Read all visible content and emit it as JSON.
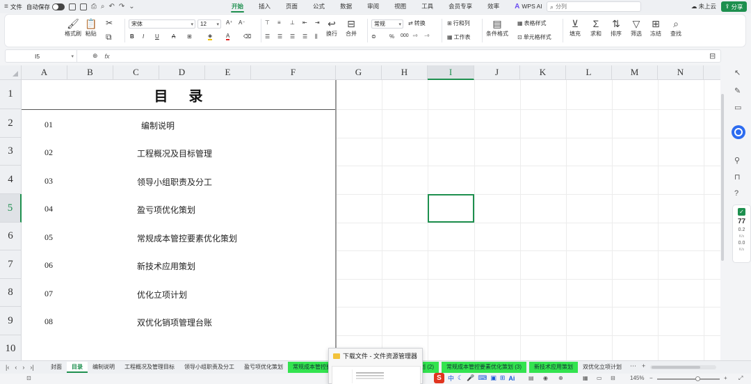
{
  "menubar": {
    "file": "文件",
    "autosave": "自动保存",
    "tabs": [
      "开始",
      "插入",
      "页面",
      "公式",
      "数据",
      "审阅",
      "视图",
      "工具",
      "会员专享",
      "效率"
    ],
    "active_tab": "开始",
    "wps_ai": "WPS AI",
    "search_placeholder": "分列",
    "cloud": "未上云",
    "share": "分享"
  },
  "ribbon": {
    "format_painter": "格式刷",
    "paste": "粘贴",
    "font_name": "宋体",
    "font_size": "12",
    "number_format": "常规",
    "convert": "转换",
    "wrap": "换行",
    "merge": "合并",
    "row_col": "行和列",
    "worksheet": "工作表",
    "cond_format": "条件格式",
    "table_style": "表格样式",
    "cell_style": "单元格样式",
    "fill": "填充",
    "sum": "求和",
    "sort": "排序",
    "filter": "筛选",
    "freeze": "冻结",
    "find": "查找",
    "percent": "%",
    "thousands": "000"
  },
  "formula_bar": {
    "cell_ref": "I5",
    "fx": "fx"
  },
  "sheet": {
    "columns": [
      "A",
      "B",
      "C",
      "D",
      "E",
      "F",
      "G",
      "H",
      "I",
      "J",
      "K",
      "L",
      "M",
      "N"
    ],
    "selected_column": "I",
    "rows": [
      "1",
      "2",
      "3",
      "4",
      "5",
      "6",
      "7",
      "8",
      "9",
      "10"
    ],
    "selected_row": "5",
    "title": "目录",
    "items": [
      {
        "num": "01",
        "name": "编制说明"
      },
      {
        "num": "02",
        "name": "工程概况及目标管理"
      },
      {
        "num": "03",
        "name": "领导小组职责及分工"
      },
      {
        "num": "04",
        "name": "盈亏项优化策划"
      },
      {
        "num": "05",
        "name": "常规成本管控要素优化策划"
      },
      {
        "num": "06",
        "name": "新技术应用策划"
      },
      {
        "num": "07",
        "name": "优化立项计划"
      },
      {
        "num": "08",
        "name": "双优化销项管理台账"
      }
    ]
  },
  "sheet_tabs": [
    {
      "label": "封面",
      "state": "normal"
    },
    {
      "label": "目录",
      "state": "active"
    },
    {
      "label": "编制说明",
      "state": "normal"
    },
    {
      "label": "工程概况及管理目标",
      "state": "normal"
    },
    {
      "label": "领导小组职责及分工",
      "state": "normal"
    },
    {
      "label": "盈亏项优化策划",
      "state": "normal"
    },
    {
      "label": "常规成本管控要素",
      "state": "green"
    },
    {
      "label": "策划 (2)",
      "state": "green"
    },
    {
      "label": "常规成本管控要素优化策划 (3)",
      "state": "green"
    },
    {
      "label": "新技术应用策划",
      "state": "green"
    },
    {
      "label": "双优化立项计划",
      "state": "normal"
    }
  ],
  "sidebar_perf": {
    "score": "77",
    "v1": "0.2",
    "v2": "0.0",
    "u1": "K/s",
    "u2": "K/s"
  },
  "popup": {
    "title": "下载文件 - 文件资源管理器"
  },
  "statusbar": {
    "zoom": "145%",
    "ime_label": "中"
  },
  "colors": {
    "accent": "#1d8f4e",
    "tab_green": "#33e34f",
    "wps_ai": "#6a4cf0"
  }
}
